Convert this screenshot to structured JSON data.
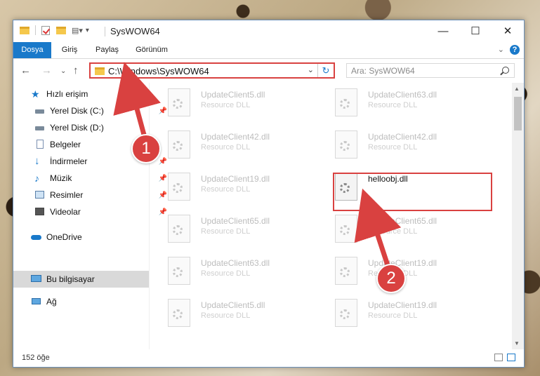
{
  "window": {
    "title": "SysWOW64"
  },
  "ribbon": {
    "tabs": [
      "Dosya",
      "Giriş",
      "Paylaş",
      "Görünüm"
    ],
    "help": "?"
  },
  "address": {
    "path": "C:\\Windows\\SysWOW64"
  },
  "search": {
    "placeholder": "Ara: SysWOW64"
  },
  "sidebar": {
    "items": [
      {
        "label": "Hızlı erişim",
        "icon": "star-icon"
      },
      {
        "label": "Yerel Disk (C:)",
        "icon": "drive-icon"
      },
      {
        "label": "Yerel Disk (D:)",
        "icon": "drive-icon"
      },
      {
        "label": "Belgeler",
        "icon": "documents-icon"
      },
      {
        "label": "İndirmeler",
        "icon": "download-icon"
      },
      {
        "label": "Müzik",
        "icon": "music-icon"
      },
      {
        "label": "Resimler",
        "icon": "pictures-icon"
      },
      {
        "label": "Videolar",
        "icon": "videos-icon"
      },
      {
        "label": "OneDrive",
        "icon": "cloud-icon"
      },
      {
        "label": "Bu bilgisayar",
        "icon": "computer-icon"
      },
      {
        "label": "Ağ",
        "icon": "network-icon"
      }
    ]
  },
  "files": [
    {
      "name": "UpdateClient5.dll",
      "type": "Resource DLL"
    },
    {
      "name": "UpdateClient63.dll",
      "type": "Resource DLL"
    },
    {
      "name": "UpdateClient42.dll",
      "type": "Resource DLL"
    },
    {
      "name": "UpdateClient42.dll",
      "type": "Resource DLL"
    },
    {
      "name": "UpdateClient19.dll",
      "type": "Resource DLL"
    },
    {
      "name": "helloobj.dll",
      "type": ""
    },
    {
      "name": "UpdateClient65.dll",
      "type": "Resource DLL"
    },
    {
      "name": "UpdateClient65.dll",
      "type": "Resource DLL"
    },
    {
      "name": "UpdateClient63.dll",
      "type": "Resource DLL"
    },
    {
      "name": "UpdateClient19.dll",
      "type": "Resource DLL"
    },
    {
      "name": "UpdateClient5.dll",
      "type": "Resource DLL"
    },
    {
      "name": "UpdateClient19.dll",
      "type": "Resource DLL"
    }
  ],
  "status": {
    "count": "152 öğe"
  },
  "callouts": [
    "1",
    "2"
  ],
  "colors": {
    "accent": "#1979ca",
    "highlight": "#d94140"
  }
}
